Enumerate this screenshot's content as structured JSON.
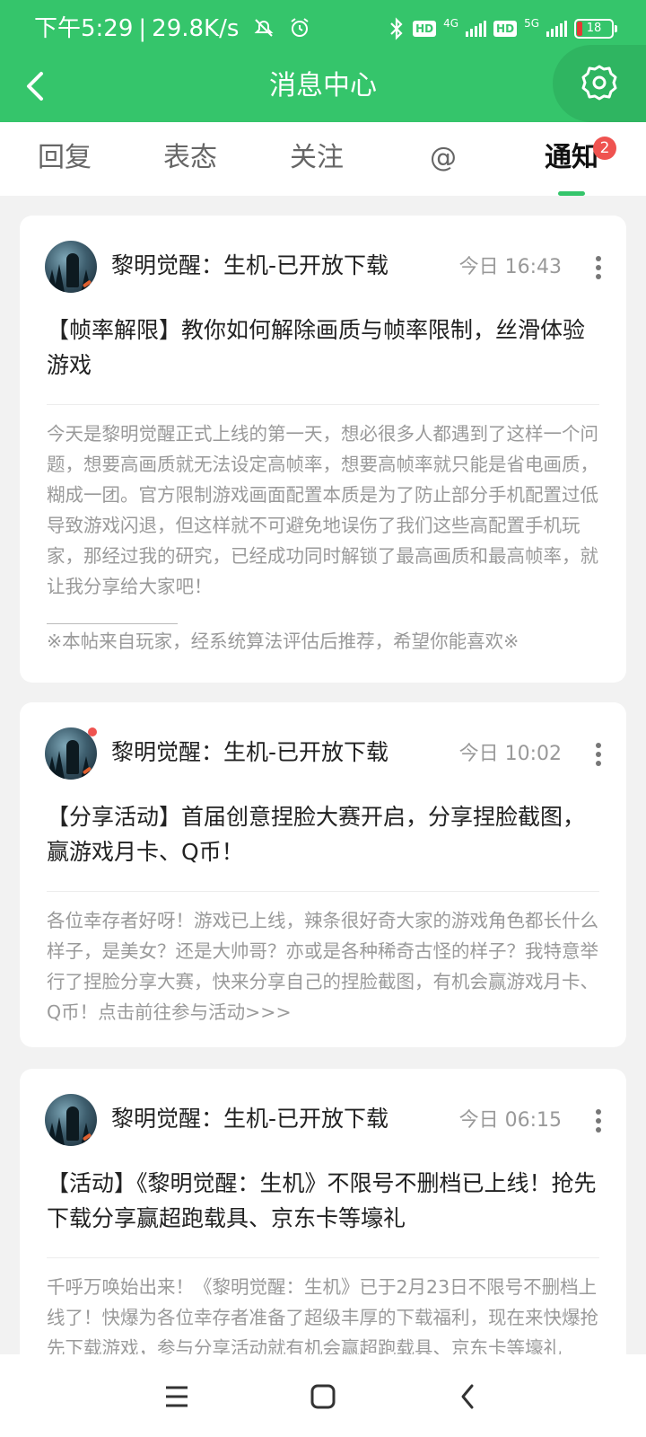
{
  "status_bar": {
    "time": "下午5:29",
    "speed": "29.8K/s",
    "net1": "4G",
    "net2": "5G",
    "battery": "18",
    "hd_label": "HD"
  },
  "header": {
    "title": "消息中心"
  },
  "tabs": [
    {
      "label": "回复"
    },
    {
      "label": "表态"
    },
    {
      "label": "关注"
    },
    {
      "label": "@"
    },
    {
      "label": "通知",
      "badge": "2",
      "active": true
    }
  ],
  "posts": [
    {
      "author": "黎明觉醒：生机-已开放下载",
      "time": "今日 16:43",
      "title": "【帧率解限】教你如何解除画质与帧率限制，丝滑体验游戏",
      "body": "今天是黎明觉醒正式上线的第一天，想必很多人都遇到了这样一个问题，想要高画质就无法设定高帧率，想要高帧率就只能是省电画质，糊成一团。官方限制游戏画面配置本质是为了防止部分手机配置过低导致游戏闪退，但这样就不可避免地误伤了我们这些高配置手机玩家，那经过我的研究，已经成功同时解锁了最高画质和最高帧率，就让我分享给大家吧！",
      "footnote": "※本帖来自玩家，经系统算法评估后推荐，希望你能喜欢※"
    },
    {
      "author": "黎明觉醒：生机-已开放下载",
      "time": "今日 10:02",
      "title": "【分享活动】首届创意捏脸大赛开启，分享捏脸截图，赢游戏月卡、Q币！",
      "body": "各位幸存者好呀！游戏已上线，辣条很好奇大家的游戏角色都长什么样子，是美女？还是大帅哥？亦或是各种稀奇古怪的样子？我特意举行了捏脸分享大赛，快来分享自己的捏脸截图，有机会赢游戏月卡、Q币！点击前往参与活动>>>"
    },
    {
      "author": "黎明觉醒：生机-已开放下载",
      "time": "今日 06:15",
      "title": "【活动】《黎明觉醒：生机》不限号不删档已上线！抢先下载分享赢超跑载具、京东卡等壕礼",
      "body": "千呼万唤始出来！《黎明觉醒：生机》已于2月23日不限号不删档上线了！快爆为各位幸存者准备了超级丰厚的下载福利，现在来快爆抢先下载游戏，参与分享活动就有机会赢超跑载具、京东卡等壕礼"
    }
  ],
  "colors": {
    "brand_green": "#35c56b",
    "badge_red": "#ef5350"
  },
  "icons": {
    "back": "back-arrow-icon",
    "settings": "gear-icon",
    "more": "more-vertical-icon",
    "nav_menu": "menu-icon",
    "nav_home": "home-icon",
    "nav_back": "back-icon"
  }
}
